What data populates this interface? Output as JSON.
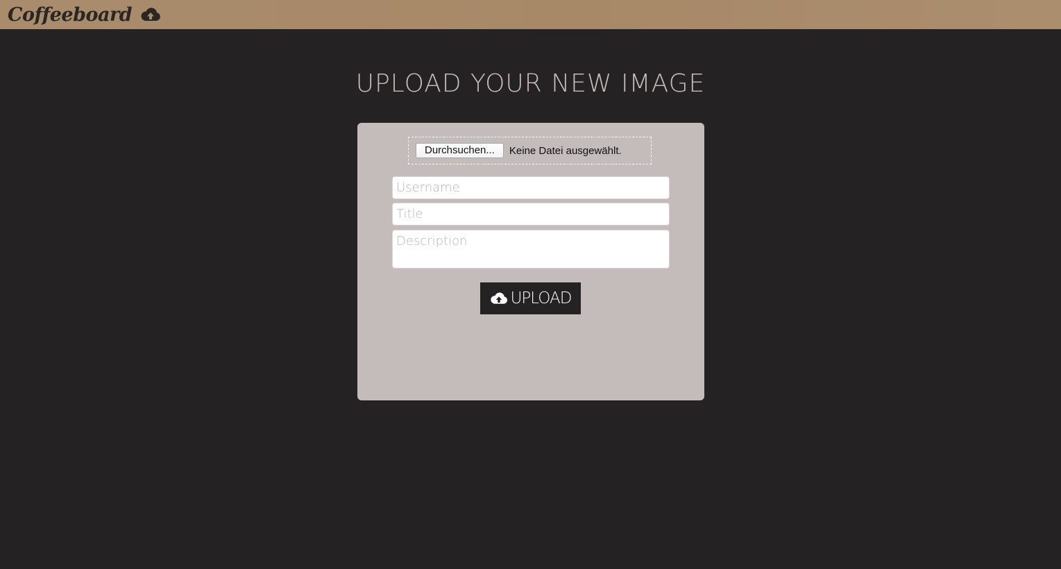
{
  "header": {
    "brand": "Coffeeboard",
    "brand_icon": "cloud-upload-icon",
    "background": "#a98c6c"
  },
  "main": {
    "title": "UPLOAD YOUR NEW IMAGE"
  },
  "form": {
    "file_button_label": "Durchsuchen...",
    "file_status": "Keine Datei ausgewählt.",
    "username": {
      "value": "",
      "placeholder": "Username"
    },
    "title": {
      "value": "",
      "placeholder": "Title"
    },
    "description": {
      "value": "",
      "placeholder": "Description"
    },
    "upload_label": "UPLOAD",
    "upload_icon": "cloud-upload-icon"
  },
  "colors": {
    "page_background": "#242223",
    "panel_background": "#c4bbbb",
    "title_text": "#c9bcbc",
    "button_background": "#242223"
  }
}
